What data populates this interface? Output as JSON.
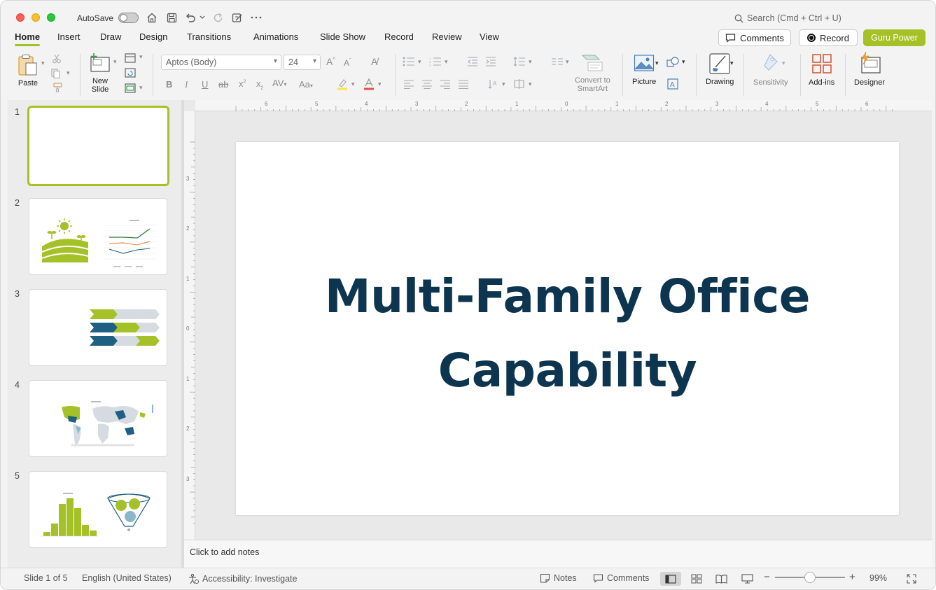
{
  "titlebar": {
    "autosave_label": "AutoSave",
    "search_placeholder": "Search (Cmd + Ctrl + U)"
  },
  "tabs": [
    "Home",
    "Insert",
    "Draw",
    "Design",
    "Transitions",
    "Animations",
    "Slide Show",
    "Record",
    "Review",
    "View"
  ],
  "actions": {
    "comments": "Comments",
    "record": "Record",
    "guru": "Guru Power"
  },
  "ribbon": {
    "paste": "Paste",
    "new_slide_line1": "New",
    "new_slide_line2": "Slide",
    "font_name": "Aptos (Body)",
    "font_size": "24",
    "convert_line1": "Convert to",
    "convert_line2": "SmartArt",
    "picture": "Picture",
    "drawing": "Drawing",
    "sensitivity": "Sensitivity",
    "addins": "Add-ins",
    "designer": "Designer"
  },
  "slides": {
    "numbers": [
      "1",
      "2",
      "3",
      "4",
      "5"
    ],
    "selected": 1
  },
  "ruler": {
    "top": [
      "6",
      "5",
      "4",
      "3",
      "2",
      "1",
      "0",
      "1",
      "2",
      "3",
      "4",
      "5",
      "6"
    ],
    "left": [
      "3",
      "2",
      "1",
      "0",
      "1",
      "2",
      "3"
    ]
  },
  "slide": {
    "title_line1": "Multi-Family Office",
    "title_line2": "Capability"
  },
  "notes": {
    "placeholder": "Click to add notes"
  },
  "status": {
    "slide_counter": "Slide 1 of 5",
    "language": "English (United States)",
    "accessibility": "Accessibility: Investigate",
    "notes": "Notes",
    "comments": "Comments",
    "zoom": "99%"
  },
  "colors": {
    "accent_green": "#a5c128",
    "title_navy": "#0d3550",
    "chart_blue": "#1f5f82"
  }
}
